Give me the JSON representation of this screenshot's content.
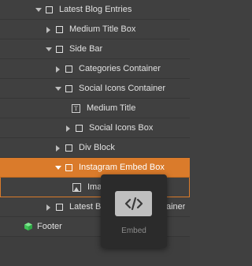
{
  "navigator": {
    "items": [
      {
        "label": "Latest Blog Entries",
        "expanded": true,
        "icon": "box-icon"
      },
      {
        "label": "Medium Title Box",
        "expanded": false,
        "icon": "box-icon"
      },
      {
        "label": "Side Bar",
        "expanded": true,
        "icon": "box-icon"
      },
      {
        "label": "Categories Container",
        "expanded": false,
        "icon": "box-icon"
      },
      {
        "label": "Social Icons Container",
        "expanded": true,
        "icon": "box-icon"
      },
      {
        "label": "Medium Title",
        "icon": "text-icon"
      },
      {
        "label": "Social Icons Box",
        "expanded": false,
        "icon": "box-icon"
      },
      {
        "label": "Div Block",
        "expanded": false,
        "icon": "box-icon"
      },
      {
        "label": "Instagram Embed Box",
        "expanded": true,
        "selected": true,
        "icon": "box-icon"
      },
      {
        "label": "Imag",
        "icon": "image-icon"
      },
      {
        "label": "Latest Bl",
        "label_tail": "ainer",
        "expanded": false,
        "icon": "box-icon"
      },
      {
        "label": "Footer",
        "icon": "symbol-cube-icon"
      }
    ]
  },
  "tooltip": {
    "caption": "Embed",
    "icon": "code-icon"
  },
  "colors": {
    "background": "#404040",
    "selected": "#da7b2b",
    "symbol_green": "#4cd964",
    "tooltip_bg": "#2b2b2b"
  }
}
